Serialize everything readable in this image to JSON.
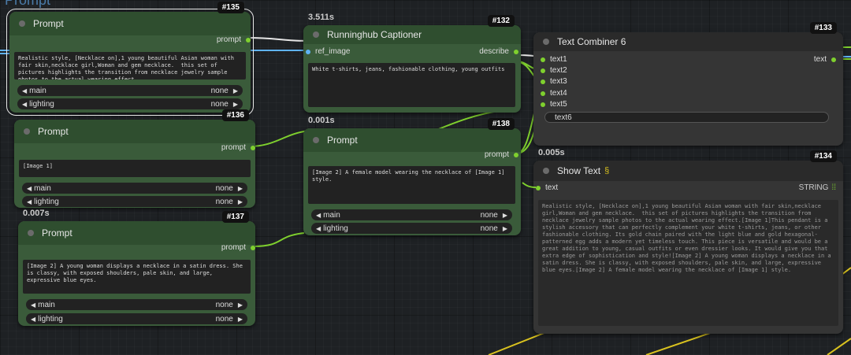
{
  "group": {
    "title": "Prompt"
  },
  "nodes": {
    "n135": {
      "id": "#135",
      "title": "Prompt",
      "output": "prompt",
      "text": "Realistic style, [Necklace on],1 young beautiful Asian woman with fair skin,necklace girl,Woman and gem necklace.  this set of pictures highlights the transition from necklace jewelry sample photos to the actual wearing effect.",
      "widgets": [
        {
          "label": "main",
          "value": "none"
        },
        {
          "label": "lighting",
          "value": "none"
        }
      ]
    },
    "n136": {
      "id": "#136",
      "title": "Prompt",
      "output": "prompt",
      "text": "[Image 1]",
      "widgets": [
        {
          "label": "main",
          "value": "none"
        },
        {
          "label": "lighting",
          "value": "none"
        }
      ]
    },
    "n137": {
      "id": "#137",
      "timing": "0.007s",
      "title": "Prompt",
      "output": "prompt",
      "text": "[Image 2] A young woman displays a necklace in a satin dress. She is classy, with exposed shoulders, pale skin, and large, expressive blue eyes.",
      "widgets": [
        {
          "label": "main",
          "value": "none"
        },
        {
          "label": "lighting",
          "value": "none"
        }
      ]
    },
    "n132": {
      "id": "#132",
      "timing": "3.511s",
      "title": "Runninghub Captioner",
      "input": "ref_image",
      "output": "describe",
      "text": "White t-shirts, jeans, fashionable clothing, young outfits"
    },
    "n138": {
      "id": "#138",
      "timing": "0.001s",
      "title": "Prompt",
      "output": "prompt",
      "text": "[Image 2] A female model wearing the necklace of [Image 1] style.",
      "widgets": [
        {
          "label": "main",
          "value": "none"
        },
        {
          "label": "lighting",
          "value": "none"
        }
      ]
    },
    "n133": {
      "id": "#133",
      "title": "Text Combiner 6",
      "inputs": [
        "text1",
        "text2",
        "text3",
        "text4",
        "text5"
      ],
      "field": "text6",
      "output": "text"
    },
    "n134": {
      "id": "#134",
      "timing": "0.005s",
      "title": "Show Text",
      "title_icon": "snake-icon",
      "input": "text",
      "type": "STRING",
      "text": "Realistic style, [Necklace on],1 young beautiful Asian woman with fair skin,necklace girl,Woman and gem necklace.  this set of pictures highlights the transition from necklace jewelry sample photos to the actual wearing effect.[Image 1]This pendant is a stylish accessory that can perfectly complement your white t-shirts, jeans, or other fashionable clothing. Its gold chain paired with the light blue and gold hexagonal-patterned egg adds a modern yet timeless touch. This piece is versatile and would be a great addition to young, casual outfits or even dressier looks. It would give you that extra edge of sophistication and style![Image 2] A young woman displays a necklace in a satin dress. She is classy, with exposed shoulders, pale skin, and large, expressive blue eyes.[Image 2] A female model wearing the necklace of [Image 1] style."
    }
  },
  "colors": {
    "node_green": "#3a5b3a",
    "node_grey": "#353535",
    "wire_green": "#7fd02e",
    "wire_blue": "#5fb3f5",
    "wire_yellow": "#d9c21f"
  }
}
